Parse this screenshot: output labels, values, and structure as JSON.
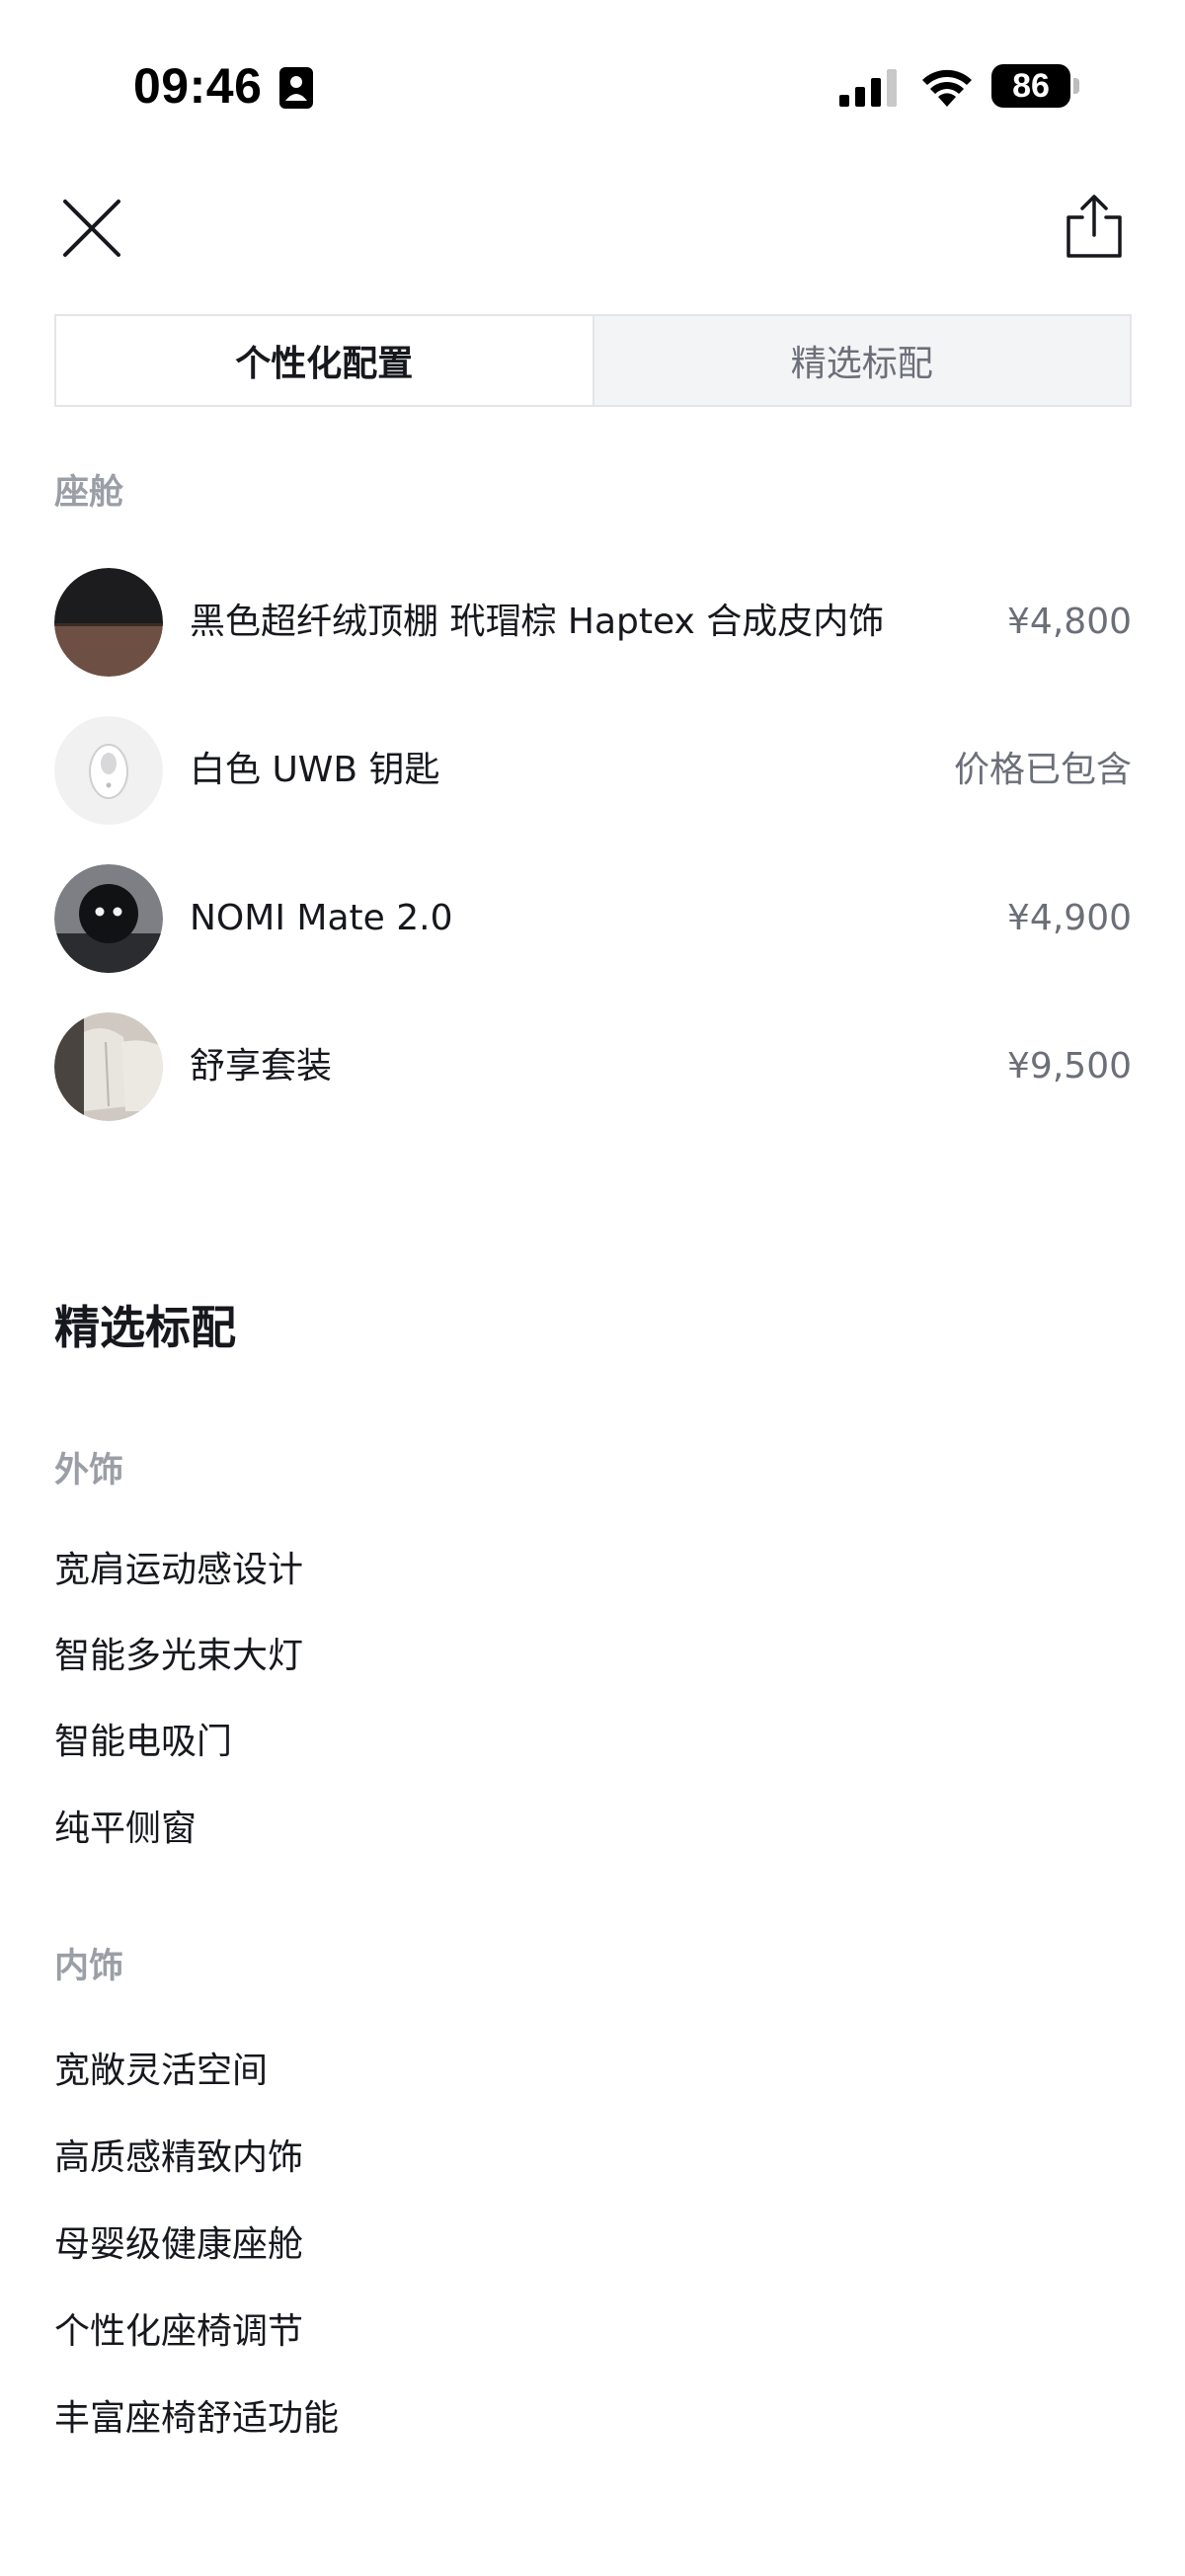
{
  "status_bar": {
    "time": "09:46",
    "battery": "86",
    "icons": [
      "portrait-lock-icon",
      "cellular-signal-icon",
      "wifi-icon",
      "battery-icon"
    ]
  },
  "nav": {
    "close_icon": "close-icon",
    "share_icon": "share-icon"
  },
  "tabs": [
    {
      "label": "个性化配置",
      "active": true
    },
    {
      "label": "精选标配",
      "active": false
    }
  ],
  "cabin": {
    "label": "座舱",
    "items": [
      {
        "name": "黑色超纤绒顶棚 玳瑁棕 Haptex 合成皮内饰",
        "price": "¥4,800",
        "thumb": "interior-material-swatch"
      },
      {
        "name": "白色 UWB 钥匙",
        "price": "价格已包含",
        "thumb": "uwb-key"
      },
      {
        "name": "NOMI Mate 2.0",
        "price": "¥4,900",
        "thumb": "nomi-mate"
      },
      {
        "name": "舒享套装",
        "price": "¥9,500",
        "thumb": "comfort-seats"
      }
    ]
  },
  "standard": {
    "heading": "精选标配",
    "exterior": {
      "label": "外饰",
      "features": [
        "宽肩运动感设计",
        "智能多光束大灯",
        "智能电吸门",
        "纯平侧窗"
      ]
    },
    "interior": {
      "label": "内饰",
      "features": [
        "宽敞灵活空间",
        "高质感精致内饰",
        "母婴级健康座舱",
        "个性化座椅调节",
        "丰富座椅舒适功能"
      ]
    }
  },
  "colors": {
    "primary_text": "#16181d",
    "secondary_text": "#6b6f78",
    "section_label": "#9a9ea6",
    "tab_border": "#e4e5e8"
  }
}
